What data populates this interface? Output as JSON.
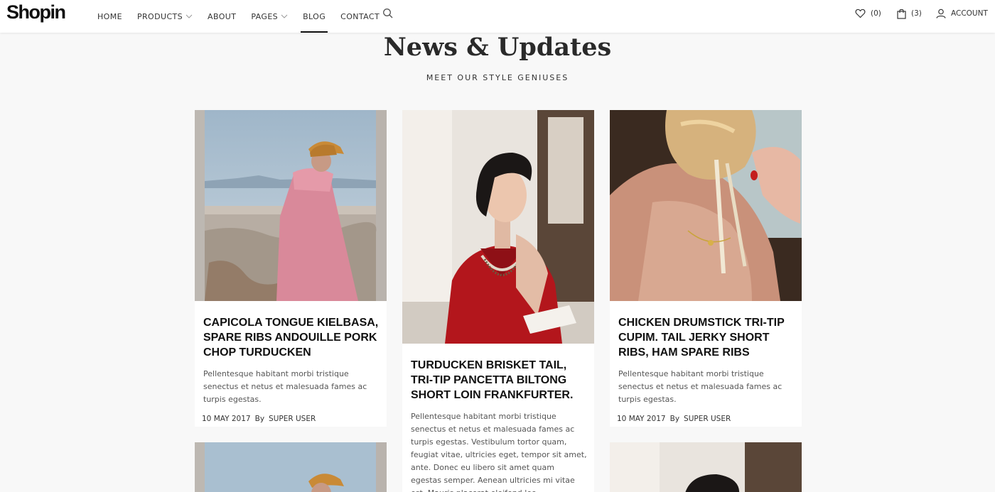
{
  "brand": {
    "logo": "Shopin"
  },
  "nav": {
    "items": [
      {
        "label": "HOME",
        "dropdown": false,
        "active": false
      },
      {
        "label": "PRODUCTS",
        "dropdown": true,
        "active": false
      },
      {
        "label": "ABOUT",
        "dropdown": false,
        "active": false
      },
      {
        "label": "PAGES",
        "dropdown": true,
        "active": false
      },
      {
        "label": "BLOG",
        "dropdown": false,
        "active": true
      },
      {
        "label": "CONTACT",
        "dropdown": false,
        "active": false
      }
    ],
    "search_icon": "search-icon"
  },
  "utility": {
    "wishlist_count": "(0)",
    "cart_count": "(3)",
    "account_label": "ACCOUNT"
  },
  "section": {
    "title": "News & Updates",
    "subtitle": "MEET OUR STYLE GENIUSES"
  },
  "posts": [
    {
      "title": "CAPICOLA TONGUE KIELBASA, SPARE RIBS ANDOUILLE PORK CHOP TURDUCKEN",
      "excerpt": "Pellentesque habitant morbi tristique senectus et netus et malesuada fames ac turpis egestas.",
      "date": "10 MAY 2017",
      "by": "By",
      "author": "SUPER USER",
      "image": "woman-in-pink-dress-and-orange-hat"
    },
    {
      "title": "TURDUCKEN BRISKET TAIL, TRI-TIP PANCETTA BILTONG SHORT LOIN FRANKFURTER.",
      "excerpt": "Pellentesque habitant morbi tristique senectus et netus et malesuada fames ac turpis egestas. Vestibulum tortor quam, feugiat vitae, ultricies eget, tempor sit amet, ante. Donec eu libero sit amet quam egestas semper. Aenean ultricies mi vitae est. Mauris placerat eleifend leo.",
      "image": "woman-in-red-shirt-with-necklace"
    },
    {
      "title": "CHICKEN DRUMSTICK TRI-TIP CUPIM. TAIL JERKY SHORT RIBS, HAM SPARE RIBS",
      "excerpt": "Pellentesque habitant morbi tristique senectus et netus et malesuada fames ac turpis egestas.",
      "date": "10 MAY 2017",
      "by": "By",
      "author": "SUPER USER",
      "image": "blonde-hair-updo-necklace"
    }
  ],
  "colors": {
    "background": "#f8f8f8",
    "card": "#ffffff",
    "text": "#111111",
    "sky": "#a9bfd0",
    "dress": "#d9899a",
    "hat": "#c98a36",
    "red_shirt": "#b3161c"
  }
}
